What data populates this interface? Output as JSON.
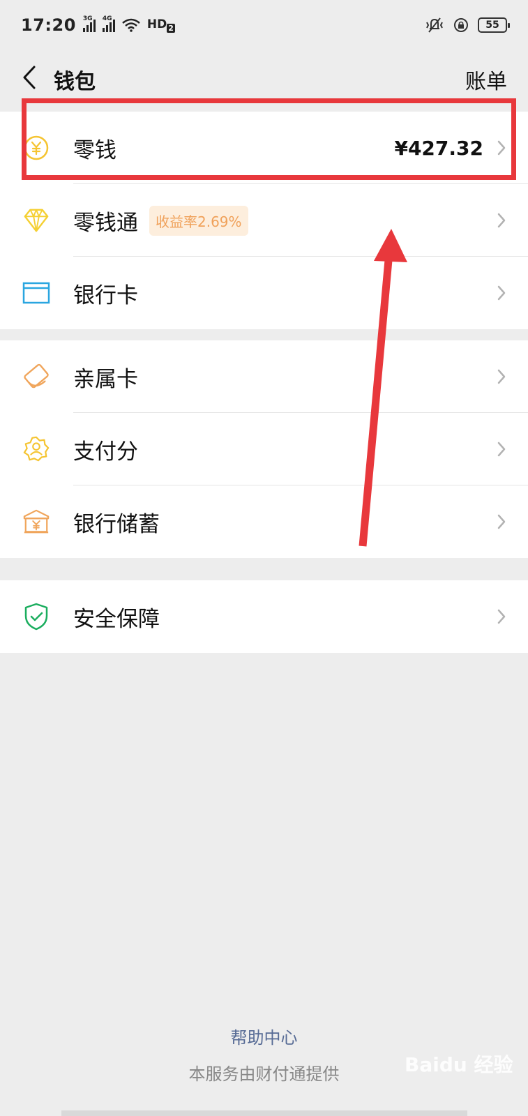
{
  "status_bar": {
    "time": "17:20",
    "signal1_label": "3G",
    "signal2_label": "4G",
    "hd_label": "HD",
    "hd_sub": "2",
    "battery": "55"
  },
  "nav": {
    "title": "钱包",
    "bill_label": "账单"
  },
  "groups": [
    {
      "items": [
        {
          "label": "零钱",
          "amount": "¥427.32",
          "icon": "yuan-coin-icon",
          "color": "#f5c431"
        },
        {
          "label": "零钱通",
          "badge": "收益率2.69%",
          "icon": "diamond-icon",
          "color": "#f5d033"
        },
        {
          "label": "银行卡",
          "icon": "bank-card-icon",
          "color": "#2aa6e0"
        }
      ]
    },
    {
      "items": [
        {
          "label": "亲属卡",
          "icon": "family-card-icon",
          "color": "#f0a55b"
        },
        {
          "label": "支付分",
          "icon": "pay-score-icon",
          "color": "#f5c431"
        },
        {
          "label": "银行储蓄",
          "icon": "bank-savings-icon",
          "color": "#f0a55b"
        }
      ]
    },
    {
      "items": [
        {
          "label": "安全保障",
          "icon": "shield-check-icon",
          "color": "#1aad5e"
        }
      ]
    }
  ],
  "footer": {
    "help_center": "帮助中心",
    "provider": "本服务由财付通提供",
    "watermark": "Baidu 经验"
  },
  "annotation": {
    "highlight_color": "#e8383c"
  }
}
